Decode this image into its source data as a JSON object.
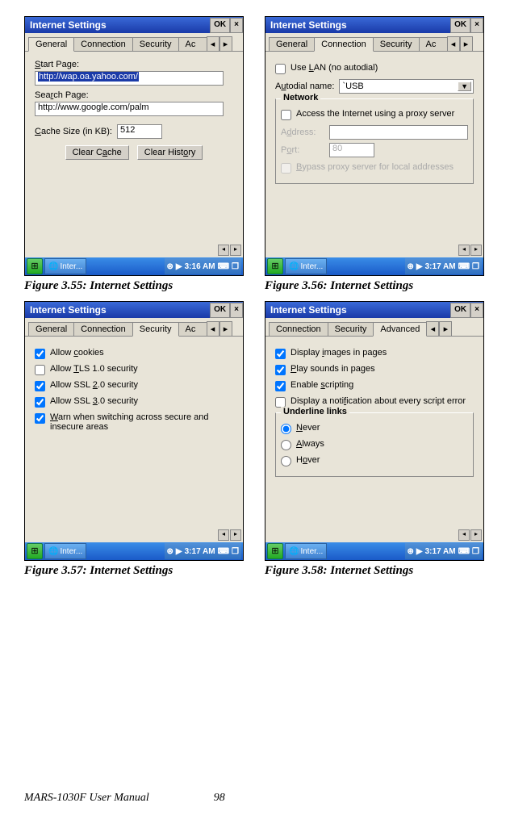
{
  "footer": {
    "title": "MARS-1030F User Manual",
    "page": "98"
  },
  "figures": [
    {
      "caption": "Figure 3.55:  Internet Settings"
    },
    {
      "caption": "Figure 3.56:  Internet Settings"
    },
    {
      "caption": "Figure 3.57:  Internet Settings"
    },
    {
      "caption": "Figure 3.58:  Internet Settings"
    }
  ],
  "common": {
    "window_title": "Internet Settings",
    "ok": "OK",
    "close": "×",
    "tabs": {
      "general": "General",
      "connection": "Connection",
      "security": "Security",
      "advanced": "Advanced",
      "ac_frag": "Ac"
    },
    "task_label": "Inter...",
    "time_55": "3:16 AM",
    "time_rest": "3:17 AM"
  },
  "fig55": {
    "start_page_label": "Start Page:",
    "start_page_value": "http://wap.oa.yahoo.com/",
    "search_page_label": "Search Page:",
    "search_page_value": "http://www.google.com/palm",
    "cache_label": "Cache Size (in KB):",
    "cache_value": "512",
    "clear_cache": "Clear Cache",
    "clear_history": "Clear History"
  },
  "fig56": {
    "use_lan": "Use LAN (no autodial)",
    "autodial_label": "Autodial name:",
    "autodial_value": "`USB",
    "network_legend": "Network",
    "proxy_label": "Access the Internet using a proxy server",
    "address_label": "Address:",
    "port_label": "Port:",
    "port_value": "80",
    "bypass_label": "Bypass proxy server for local addresses"
  },
  "fig57": {
    "allow_cookies": "Allow cookies",
    "allow_tls": "Allow TLS 1.0 security",
    "allow_ssl2": "Allow SSL 2.0 security",
    "allow_ssl3": "Allow SSL 3.0 security",
    "warn_secure": "Warn when switching across secure and insecure areas"
  },
  "fig58": {
    "display_images": "Display images in pages",
    "play_sounds": "Play sounds in pages",
    "enable_scripting": "Enable scripting",
    "script_notify": "Display a notification about every script error",
    "underline_legend": "Underline links",
    "never": "Never",
    "always": "Always",
    "hover": "Hover"
  }
}
